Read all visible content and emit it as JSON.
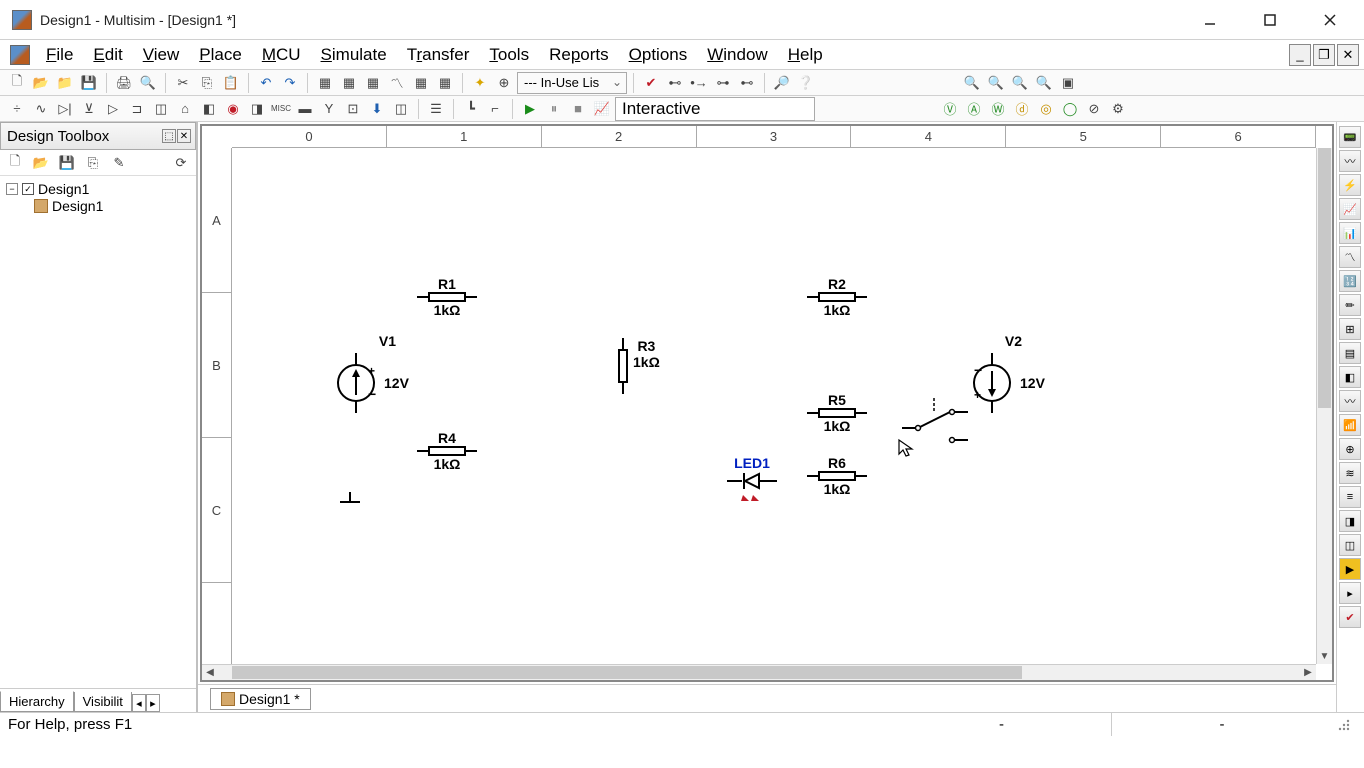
{
  "title": "Design1 - Multisim - [Design1 *]",
  "menu": [
    "File",
    "Edit",
    "View",
    "Place",
    "MCU",
    "Simulate",
    "Transfer",
    "Tools",
    "Reports",
    "Options",
    "Window",
    "Help"
  ],
  "combo_inuse": "--- In-Use Lis",
  "sim_mode": "Interactive",
  "toolbox": {
    "title": "Design Toolbox",
    "root": "Design1",
    "child": "Design1",
    "tab_hierarchy": "Hierarchy",
    "tab_visibility": "Visibilit"
  },
  "ruler_cols": [
    "0",
    "1",
    "2",
    "3",
    "4",
    "5",
    "6"
  ],
  "ruler_rows": [
    "A",
    "B",
    "C"
  ],
  "components": {
    "v1": {
      "name": "V1",
      "val": "12V"
    },
    "v2": {
      "name": "V2",
      "val": "12V"
    },
    "r1": {
      "name": "R1",
      "val": "1kΩ"
    },
    "r2": {
      "name": "R2",
      "val": "1kΩ"
    },
    "r3": {
      "name": "R3",
      "val": "1kΩ"
    },
    "r4": {
      "name": "R4",
      "val": "1kΩ"
    },
    "r5": {
      "name": "R5",
      "val": "1kΩ"
    },
    "r6": {
      "name": "R6",
      "val": "1kΩ"
    },
    "led1": {
      "name": "LED1"
    }
  },
  "doc_tab": "Design1 *",
  "status_help": "For Help, press F1",
  "status_seg1": "-",
  "status_seg2": "-"
}
